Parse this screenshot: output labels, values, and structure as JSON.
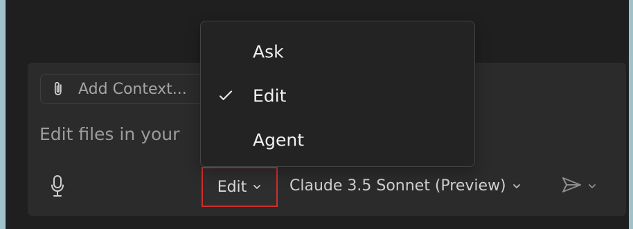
{
  "composer": {
    "add_context_label": "Add Context...",
    "placeholder_text": "Edit files in your",
    "mode_label": "Edit",
    "model_label": "Claude 3.5 Sonnet (Preview)"
  },
  "menu": {
    "items": [
      {
        "label": "Ask",
        "selected": false
      },
      {
        "label": "Edit",
        "selected": true
      },
      {
        "label": "Agent",
        "selected": false
      }
    ]
  },
  "icons": {
    "attach": "paperclip-icon",
    "microphone": "microphone-icon",
    "dropdown": "chevron-down-icon",
    "send": "send-icon",
    "check": "check-icon"
  },
  "colors": {
    "background_outer": "#9fc3cc",
    "background_app": "#1f1f1f",
    "panel": "#2b2b2b",
    "menu": "#232323",
    "highlight": "#d22d2d"
  }
}
